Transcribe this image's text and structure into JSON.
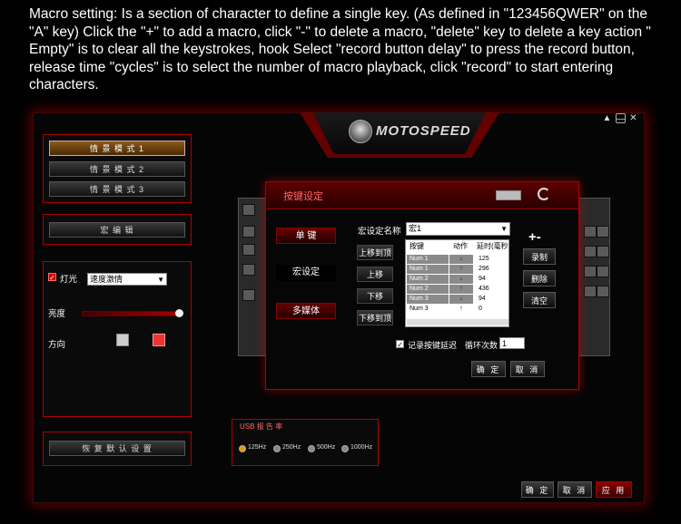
{
  "caption": "Macro setting: Is a section of character to define a single key. (As defined in \"123456QWER\" on the \"A\" key) Click the \"+\" to add a macro, click \"-\" to delete a macro, \"delete\" key to delete a key action \" Empty\" is to clear all the keystrokes, hook Select \"record button delay\" to press the record button, release time \"cycles\" is to select the number of macro playback, click \"record\" to start entering characters.",
  "brand": "MOTOSPEED",
  "window_controls": {
    "up": "▲",
    "min": "—",
    "close": "✕"
  },
  "modes": [
    "情 景 模 式 1",
    "情 景 模 式 2",
    "情 景 模 式 3"
  ],
  "macro_edit_label": "宏 编 辑",
  "light": {
    "label": "灯光",
    "effect": "速度激情",
    "brightness_label": "亮度",
    "direction_label": "方向"
  },
  "restore_label": "恢 复 默 认 设 置",
  "usb": {
    "label": "USB 报 告 率",
    "options": [
      "125Hz",
      "250Hz",
      "500Hz",
      "1000Hz"
    ],
    "selected": "125Hz"
  },
  "bottom_buttons": {
    "ok": "确 定",
    "cancel": "取 消",
    "apply": "应 用"
  },
  "dialog": {
    "title": "按键设定",
    "tabs": [
      "单 键",
      "宏设定",
      "多媒体"
    ],
    "active_tab": "宏设定",
    "macro_name_label": "宏设定名称",
    "macro_name_value": "宏1",
    "move_buttons": [
      "上移到顶",
      "上移",
      "下移",
      "下移到顶"
    ],
    "plus_minus": "+-",
    "record_label": "录制",
    "delete_label": "删除",
    "clear_label": "清空",
    "table": {
      "headers": [
        "按键",
        "动作",
        "延时(毫秒"
      ],
      "rows": [
        {
          "key": "Num 1",
          "action": "↓",
          "delay": "125"
        },
        {
          "key": "Num 1",
          "action": "↑",
          "delay": "296"
        },
        {
          "key": "Num 2",
          "action": "↓",
          "delay": "94"
        },
        {
          "key": "Num 2",
          "action": "↑",
          "delay": "436"
        },
        {
          "key": "Num 3",
          "action": "↓",
          "delay": "94"
        },
        {
          "key": "Num 3",
          "action": "↑",
          "delay": "0"
        }
      ]
    },
    "record_delay_label": "记录按键延迟",
    "loop_label": "循环次数",
    "loop_value": "1",
    "ok": "确 定",
    "cancel": "取 消"
  },
  "colors": {
    "accent_red": "#b00000",
    "active_mode": "#8a5a1a"
  }
}
